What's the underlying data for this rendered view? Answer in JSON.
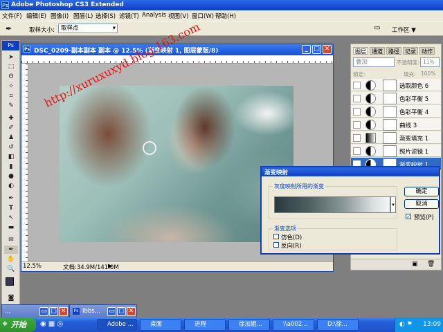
{
  "app": {
    "title": "Adobe Photoshop CS3 Extended",
    "logo": "Ps"
  },
  "menubar": [
    "文件(F)",
    "编辑(E)",
    "图像(I)",
    "图层(L)",
    "选择(S)",
    "滤镜(T)",
    "Analysis",
    "视图(V)",
    "窗口(W)",
    "帮助(H)"
  ],
  "options": {
    "sample_size_label": "取样大小:",
    "sample_size_value": "取样点",
    "workspace_label": "工作区 ▼"
  },
  "document": {
    "title": "DSC_0209-副本副本 副本 @ 12.5% (渐变映射 1, 图层蒙版/8)",
    "watermark": "http://xuruxuxyd.blog.163.com",
    "zoom": "12.5%",
    "doc_info": "文档:34.9M/141.0M"
  },
  "layers_panel": {
    "tabs": [
      "图层",
      "通道",
      "路径",
      "记录",
      "动作"
    ],
    "blend_mode": "叠加",
    "opacity_label": "不透明度:",
    "opacity_value": "11%",
    "lock_label": "锁定:",
    "fill_label": "填充:",
    "fill_value": "100%",
    "layers": [
      {
        "name": "选取颜色 6",
        "selected": false
      },
      {
        "name": "色彩平衡 5",
        "selected": false
      },
      {
        "name": "色彩平衡 4",
        "selected": false
      },
      {
        "name": "曲线 3",
        "selected": false
      },
      {
        "name": "渐变填充 1",
        "selected": false
      },
      {
        "name": "照片滤镜 1",
        "selected": false
      },
      {
        "name": "渐变映射 1",
        "selected": true
      }
    ]
  },
  "dialog": {
    "title": "渐变映射",
    "group1_label": "灰度映射所用的渐变",
    "group2_label": "渐变选项",
    "dither_label": "仿色(D)",
    "reverse_label": "反向(R)",
    "ok_label": "确定",
    "cancel_label": "取消",
    "preview_label": "预览(P)",
    "preview_checked": true,
    "gradient_colors": [
      "#2a3a3e",
      "#4f6060",
      "#8a9898",
      "#d8dede",
      "#f4f6f6"
    ]
  },
  "minimized_windows": [
    {
      "title": "Ibbs..."
    }
  ],
  "taskbar": {
    "start_label": "开始",
    "tasks": [
      "Adobe ...",
      "桌面",
      "进程",
      "徐加姐...",
      "\\\\a002...",
      "D:\\徐..."
    ],
    "clock": "13:09"
  }
}
